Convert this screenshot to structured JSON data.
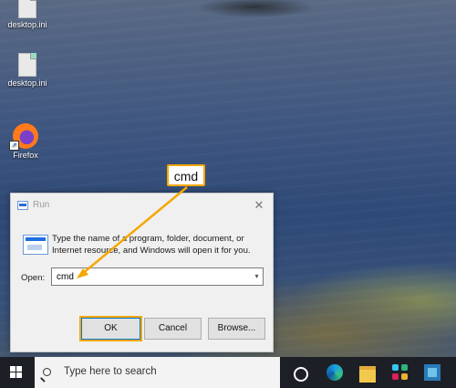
{
  "desktop": {
    "icons": [
      {
        "label": "desktop.ini",
        "icon": "file-icon"
      },
      {
        "label": "desktop.ini",
        "icon": "file-icon"
      },
      {
        "label": "Firefox",
        "icon": "firefox-icon"
      }
    ]
  },
  "callout": {
    "text": "cmd"
  },
  "run_dialog": {
    "title": "Run",
    "description": "Type the name of a program, folder, document, or Internet resource, and Windows will open it for you.",
    "open_label": "Open:",
    "open_value": "cmd",
    "buttons": {
      "ok": "OK",
      "cancel": "Cancel",
      "browse": "Browse..."
    }
  },
  "taskbar": {
    "search_placeholder": "Type here to search",
    "pinned": [
      "cortana-icon",
      "edge-icon",
      "file-explorer-icon",
      "slack-icon",
      "app-icon"
    ]
  },
  "colors": {
    "highlight": "#f5a700",
    "taskbar": "#1c2026",
    "dialog_bg": "#f0f0f0"
  }
}
